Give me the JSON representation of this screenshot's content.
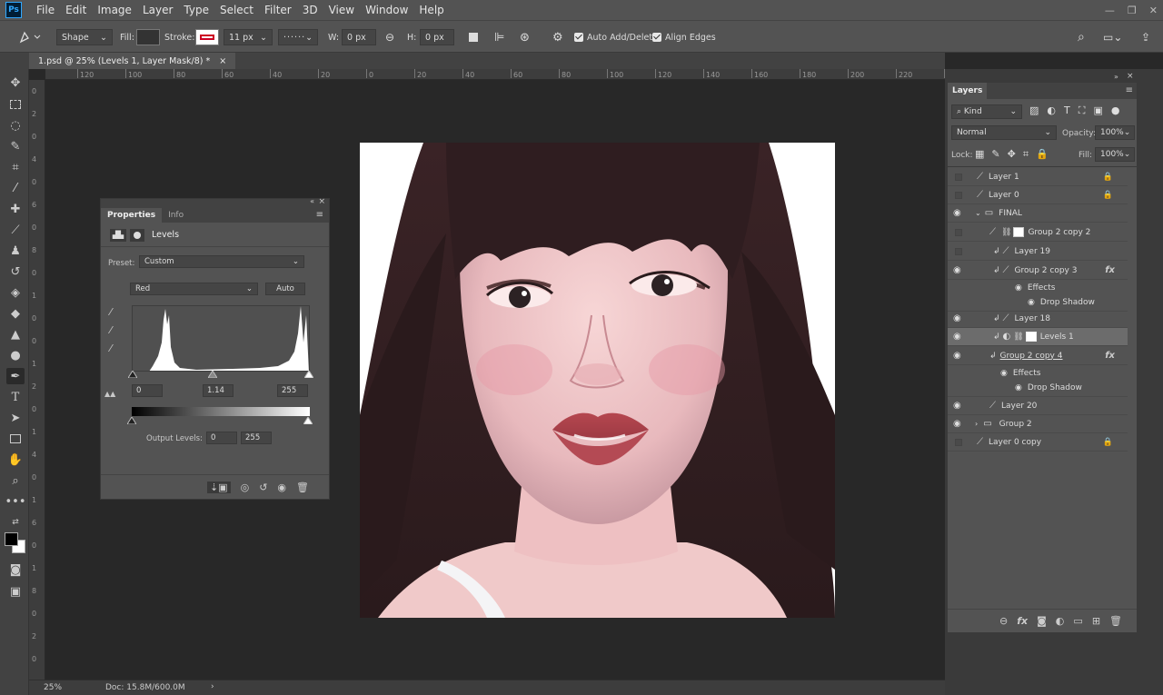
{
  "menu": {
    "logo": "Ps",
    "items": [
      "File",
      "Edit",
      "Image",
      "Layer",
      "Type",
      "Select",
      "Filter",
      "3D",
      "View",
      "Window",
      "Help"
    ],
    "controls": [
      "—",
      "❐",
      "✕"
    ]
  },
  "options": {
    "tool_mode": "Shape",
    "fill_label": "Fill:",
    "stroke_label": "Stroke:",
    "stroke_width": "11 px",
    "w_label": "W:",
    "w_value": "0 px",
    "h_label": "H:",
    "h_value": "0 px",
    "auto_add_delete": "Auto Add/Delete",
    "align_edges": "Align Edges"
  },
  "document": {
    "tab_title": "1.psd @ 25% (Levels 1, Layer Mask/8) *",
    "close": "×",
    "zoom": "25%",
    "doc_info": "Doc: 15.8M/600.0M"
  },
  "ruler_top_labels": [
    "120",
    "100",
    "80",
    "60",
    "40",
    "20",
    "0",
    "20",
    "40",
    "60",
    "80",
    "100",
    "120",
    "140",
    "160",
    "180",
    "200",
    "220",
    "240"
  ],
  "ruler_left_labels": [
    "0",
    "2",
    "0",
    "4",
    "0",
    "6",
    "0",
    "8",
    "0",
    "1",
    "0",
    "0",
    "1",
    "2",
    "0",
    "1",
    "4",
    "0",
    "1",
    "6",
    "0",
    "1",
    "8",
    "0",
    "2",
    "0"
  ],
  "properties": {
    "tabs": [
      "Properties",
      "Info"
    ],
    "adjustment_title": "Levels",
    "preset_label": "Preset:",
    "preset_value": "Custom",
    "channel_value": "Red",
    "auto_label": "Auto",
    "input_black": "0",
    "input_mid": "1.14",
    "input_white": "255",
    "output_label": "Output Levels:",
    "output_black": "0",
    "output_white": "255"
  },
  "layers_panel": {
    "title": "Layers",
    "filter_kind": "Kind",
    "blend_mode": "Normal",
    "opacity_label": "Opacity:",
    "opacity_value": "100%",
    "lock_label": "Lock:",
    "fill_label": "Fill:",
    "fill_value": "100%",
    "rows": [
      {
        "name": "Layer 1",
        "visible": false,
        "locked": true
      },
      {
        "name": "Layer 0",
        "visible": false,
        "locked": true
      },
      {
        "name": "FINAL",
        "visible": true,
        "group": true
      },
      {
        "name": "Group 2 copy 2",
        "visible": false
      },
      {
        "name": "Layer 19",
        "visible": false
      },
      {
        "name": "Group 2 copy 3",
        "visible": true,
        "fx": true
      },
      {
        "name": "Effects",
        "sub": true
      },
      {
        "name": "Drop Shadow",
        "sub2": true
      },
      {
        "name": "Layer 18",
        "visible": true
      },
      {
        "name": "Levels 1",
        "visible": true,
        "selected": true
      },
      {
        "name": "Group 2 copy 4",
        "visible": true,
        "fx": true
      },
      {
        "name": "Effects",
        "sub": true
      },
      {
        "name": "Drop Shadow",
        "sub2": true
      },
      {
        "name": "Layer 20",
        "visible": true
      },
      {
        "name": "Group 2",
        "visible": true,
        "group": true
      },
      {
        "name": "Layer 0 copy",
        "visible": false,
        "locked": true
      }
    ]
  },
  "colors": {
    "chrome": "#535353",
    "dark": "#424242",
    "workspace": "#282828",
    "accent": "#31a8ff"
  }
}
